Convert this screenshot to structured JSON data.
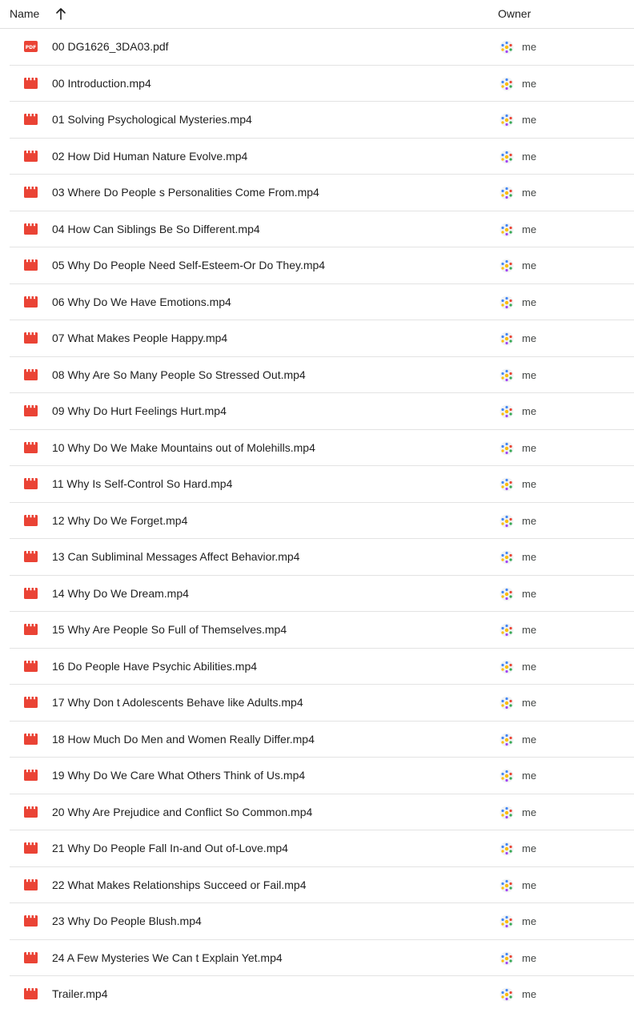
{
  "header": {
    "name_label": "Name",
    "owner_label": "Owner",
    "sort_icon": "arrow-up-icon"
  },
  "colors": {
    "file_icon_red": "#ea4335",
    "divider": "#e3e3e3"
  },
  "files": [
    {
      "name": "00 DG1626_3DA03.pdf",
      "type": "pdf",
      "owner": "me"
    },
    {
      "name": "00 Introduction.mp4",
      "type": "video",
      "owner": "me"
    },
    {
      "name": "01 Solving Psychological Mysteries.mp4",
      "type": "video",
      "owner": "me"
    },
    {
      "name": "02 How Did Human Nature Evolve.mp4",
      "type": "video",
      "owner": "me"
    },
    {
      "name": "03 Where Do People s Personalities Come From.mp4",
      "type": "video",
      "owner": "me"
    },
    {
      "name": "04 How Can Siblings Be So Different.mp4",
      "type": "video",
      "owner": "me"
    },
    {
      "name": "05 Why Do People Need Self-Esteem-Or Do They.mp4",
      "type": "video",
      "owner": "me"
    },
    {
      "name": "06 Why Do We Have Emotions.mp4",
      "type": "video",
      "owner": "me"
    },
    {
      "name": "07 What Makes People Happy.mp4",
      "type": "video",
      "owner": "me"
    },
    {
      "name": "08 Why Are So Many People So Stressed Out.mp4",
      "type": "video",
      "owner": "me"
    },
    {
      "name": "09 Why Do Hurt Feelings Hurt.mp4",
      "type": "video",
      "owner": "me"
    },
    {
      "name": "10 Why Do We Make Mountains out of Molehills.mp4",
      "type": "video",
      "owner": "me"
    },
    {
      "name": "11 Why Is Self-Control So Hard.mp4",
      "type": "video",
      "owner": "me"
    },
    {
      "name": "12 Why Do We Forget.mp4",
      "type": "video",
      "owner": "me"
    },
    {
      "name": "13 Can Subliminal Messages Affect Behavior.mp4",
      "type": "video",
      "owner": "me"
    },
    {
      "name": "14 Why Do We Dream.mp4",
      "type": "video",
      "owner": "me"
    },
    {
      "name": "15 Why Are People So Full of Themselves.mp4",
      "type": "video",
      "owner": "me"
    },
    {
      "name": "16 Do People Have Psychic Abilities.mp4",
      "type": "video",
      "owner": "me"
    },
    {
      "name": "17 Why Don t Adolescents Behave like Adults.mp4",
      "type": "video",
      "owner": "me"
    },
    {
      "name": "18 How Much Do Men and Women Really Differ.mp4",
      "type": "video",
      "owner": "me"
    },
    {
      "name": "19 Why Do We Care What Others Think of Us.mp4",
      "type": "video",
      "owner": "me"
    },
    {
      "name": "20 Why Are Prejudice and Conflict So Common.mp4",
      "type": "video",
      "owner": "me"
    },
    {
      "name": "21 Why Do People Fall In-and Out of-Love.mp4",
      "type": "video",
      "owner": "me"
    },
    {
      "name": "22 What Makes Relationships Succeed or Fail.mp4",
      "type": "video",
      "owner": "me"
    },
    {
      "name": "23 Why Do People Blush.mp4",
      "type": "video",
      "owner": "me"
    },
    {
      "name": "24 A Few Mysteries We Can t Explain Yet.mp4",
      "type": "video",
      "owner": "me"
    },
    {
      "name": "Trailer.mp4",
      "type": "video",
      "owner": "me"
    }
  ]
}
